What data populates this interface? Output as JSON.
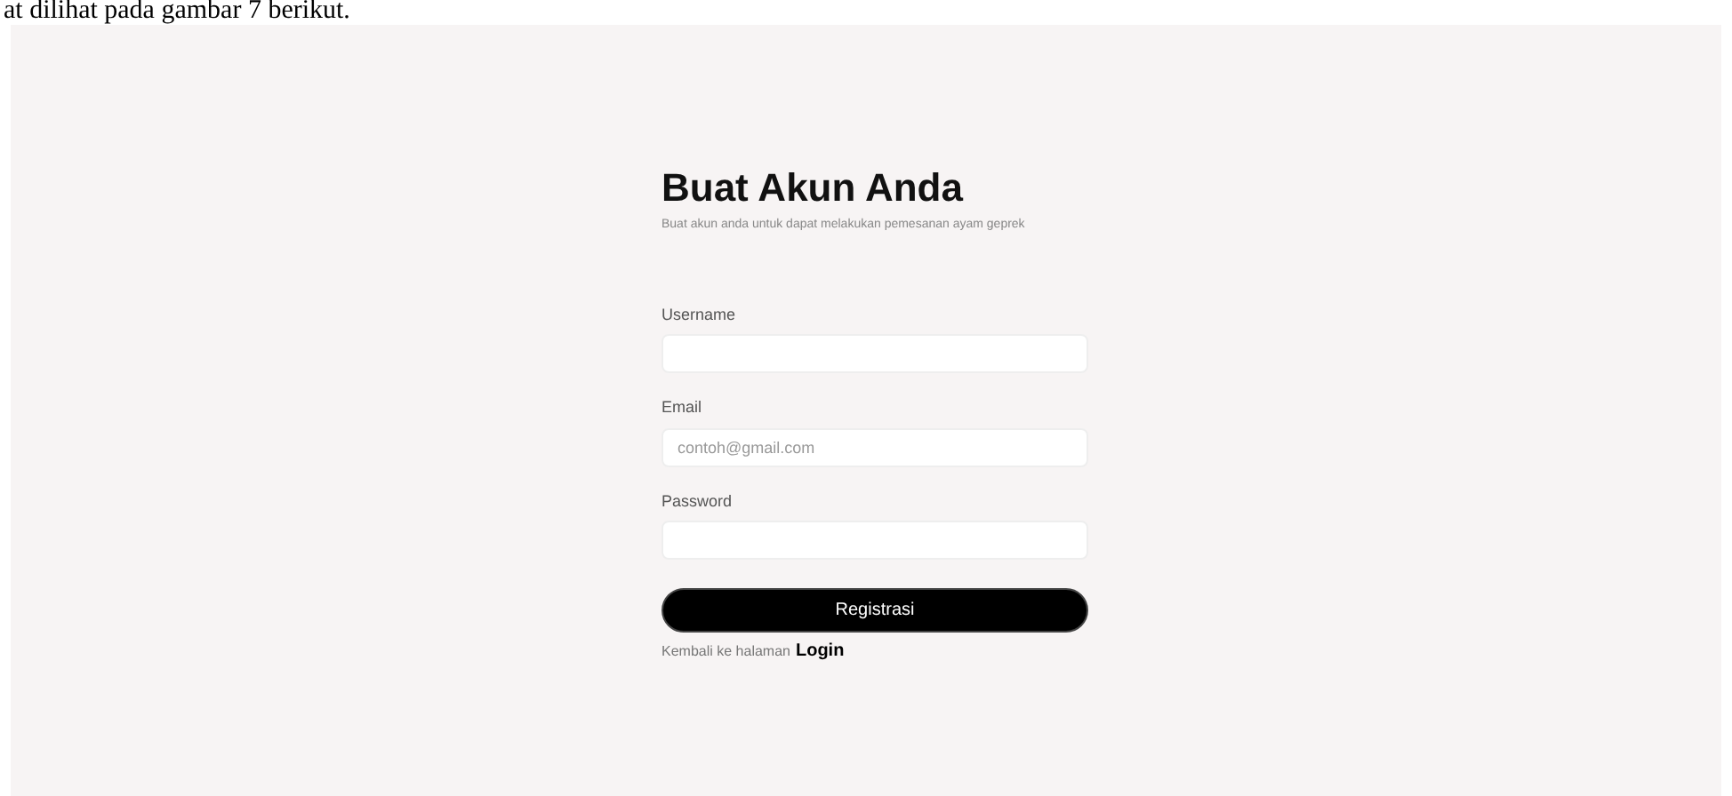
{
  "caption": "at dilihat pada gambar 7 berikut.",
  "title": "Buat Akun Anda",
  "subtitle": "Buat akun anda untuk dapat melakukan pemesanan ayam geprek",
  "fields": [
    {
      "label": "Username"
    },
    {
      "label": "Email",
      "placeholder": "contoh@gmail.com"
    },
    {
      "label": "Password"
    }
  ],
  "submit": "Registrasi",
  "footer": {
    "text": "Kembali ke halaman",
    "link": "Login"
  }
}
